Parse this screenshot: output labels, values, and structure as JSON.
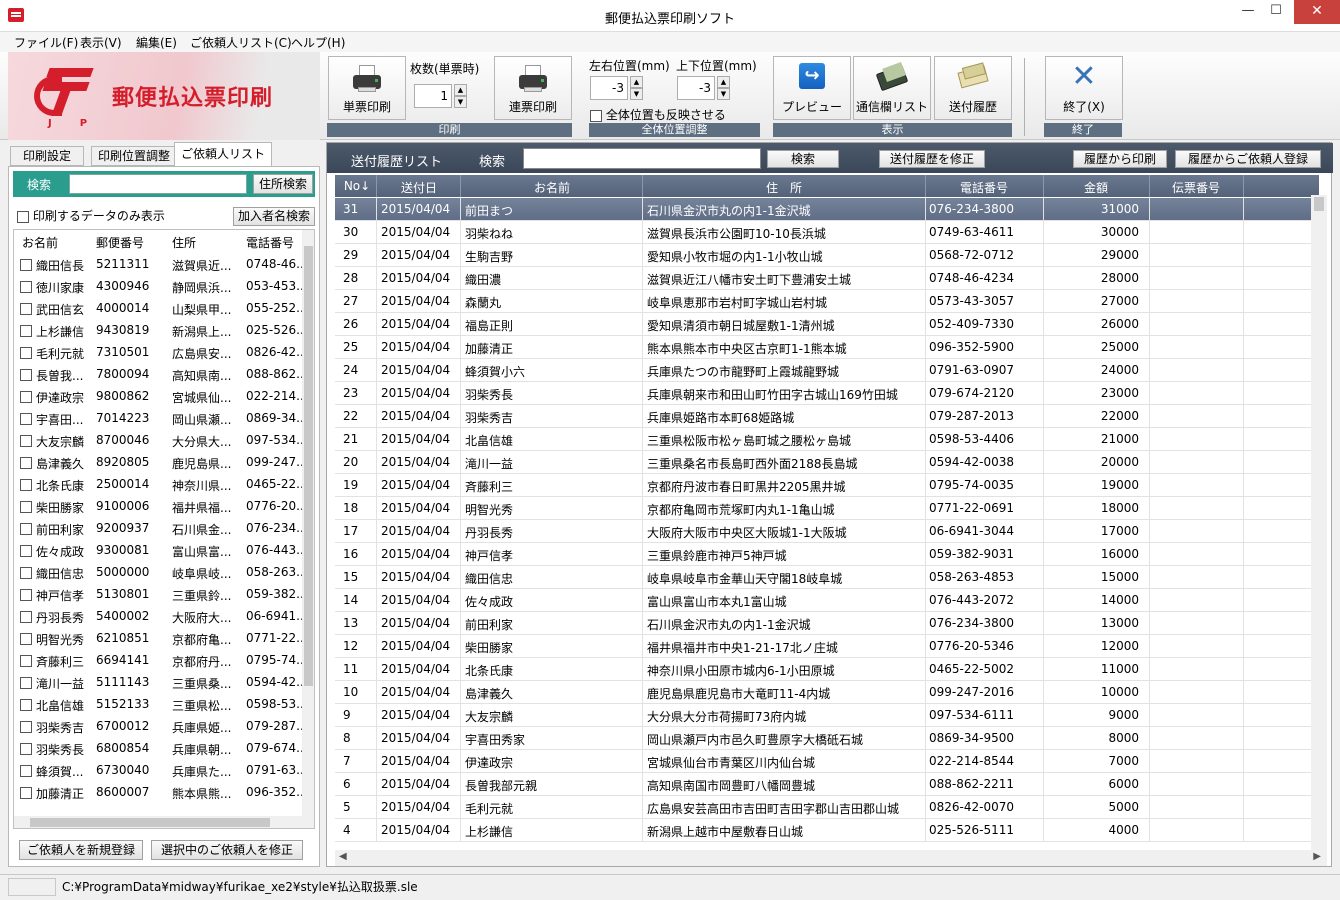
{
  "window": {
    "title": "郵便払込票印刷ソフト",
    "min": "—",
    "max": "☐",
    "close": "✕"
  },
  "menu": [
    "ファイル(F)",
    "表示(V)",
    "編集(E)",
    "ご依頼人リスト(C)",
    "ヘルプ(H)"
  ],
  "logo": {
    "jp": "JP",
    "name": "郵便払込票印刷"
  },
  "ribbon": {
    "print_group": "印刷",
    "single_print": "単票印刷",
    "count_label": "枚数(単票時)",
    "count_value": "1",
    "continuous_print": "連票印刷",
    "position_group": "全体位置調整",
    "lr_label": "左右位置(mm)",
    "lr_value": "-3",
    "tb_label": "上下位置(mm)",
    "tb_value": "-3",
    "apply_all": "全体位置も反映させる",
    "display_group": "表示",
    "preview": "プレビュー",
    "comm_list": "通信欄リスト",
    "send_history": "送付履歴",
    "end_group": "終了",
    "exit": "終了(X)"
  },
  "left": {
    "tabs": [
      "印刷設定",
      "印刷位置調整",
      "ご依頼人リスト"
    ],
    "search_label": "検索",
    "address_search": "住所検索",
    "only_print_label": "印刷するデータのみ表示",
    "name_search": "加入者名検索",
    "columns": [
      "お名前",
      "郵便番号",
      "住所",
      "電話番号"
    ],
    "rows": [
      [
        "織田信長",
        "5211311",
        "滋賀県近...",
        "0748-46..."
      ],
      [
        "徳川家康",
        "4300946",
        "静岡県浜...",
        "053-453..."
      ],
      [
        "武田信玄",
        "4000014",
        "山梨県甲...",
        "055-252..."
      ],
      [
        "上杉謙信",
        "9430819",
        "新潟県上...",
        "025-526..."
      ],
      [
        "毛利元就",
        "7310501",
        "広島県安...",
        "0826-42..."
      ],
      [
        "長曽我...",
        "7800094",
        "高知県南...",
        "088-862..."
      ],
      [
        "伊達政宗",
        "9800862",
        "宮城県仙...",
        "022-214..."
      ],
      [
        "宇喜田...",
        "7014223",
        "岡山県瀬...",
        "0869-34..."
      ],
      [
        "大友宗麟",
        "8700046",
        "大分県大...",
        "097-534..."
      ],
      [
        "島津義久",
        "8920805",
        "鹿児島県...",
        "099-247..."
      ],
      [
        "北条氏康",
        "2500014",
        "神奈川県...",
        "0465-22..."
      ],
      [
        "柴田勝家",
        "9100006",
        "福井県福...",
        "0776-20..."
      ],
      [
        "前田利家",
        "9200937",
        "石川県金...",
        "076-234..."
      ],
      [
        "佐々成政",
        "9300081",
        "富山県富...",
        "076-443..."
      ],
      [
        "織田信忠",
        "5000000",
        "岐阜県岐...",
        "058-263..."
      ],
      [
        "神戸信孝",
        "5130801",
        "三重県鈴...",
        "059-382..."
      ],
      [
        "丹羽長秀",
        "5400002",
        "大阪府大...",
        "06-6941..."
      ],
      [
        "明智光秀",
        "6210851",
        "京都府亀...",
        "0771-22..."
      ],
      [
        "斉藤利三",
        "6694141",
        "京都府丹...",
        "0795-74..."
      ],
      [
        "滝川一益",
        "5111143",
        "三重県桑...",
        "0594-42..."
      ],
      [
        "北畠信雄",
        "5152133",
        "三重県松...",
        "0598-53..."
      ],
      [
        "羽柴秀吉",
        "6700012",
        "兵庫県姫...",
        "079-287..."
      ],
      [
        "羽柴秀長",
        "6800854",
        "兵庫県朝...",
        "079-674..."
      ],
      [
        "蜂須賀...",
        "6730040",
        "兵庫県た...",
        "0791-63..."
      ],
      [
        "加藤清正",
        "8600007",
        "熊本県熊...",
        "096-352..."
      ]
    ],
    "new_client": "ご依頼人を新規登録",
    "edit_client": "選択中のご依頼人を修正"
  },
  "main": {
    "title": "送付履歴リスト",
    "search_label": "検索",
    "search_btn": "検索",
    "fix_history": "送付履歴を修正",
    "print_from_history": "履歴から印刷",
    "register_from_history": "履歴からご依頼人登録",
    "columns": [
      "No↓",
      "送付日",
      "お名前",
      "住　所",
      "電話番号",
      "金額",
      "伝票番号"
    ],
    "rows": [
      [
        "31",
        "2015/04/04",
        "前田まつ",
        "石川県金沢市丸の内1-1金沢城",
        "076-234-3800",
        "31000"
      ],
      [
        "30",
        "2015/04/04",
        "羽柴ねね",
        "滋賀県長浜市公園町10-10長浜城",
        "0749-63-4611",
        "30000"
      ],
      [
        "29",
        "2015/04/04",
        "生駒吉野",
        "愛知県小牧市堀の内1-1小牧山城",
        "0568-72-0712",
        "29000"
      ],
      [
        "28",
        "2015/04/04",
        "織田濃",
        "滋賀県近江八幡市安土町下豊浦安土城",
        "0748-46-4234",
        "28000"
      ],
      [
        "27",
        "2015/04/04",
        "森蘭丸",
        "岐阜県恵那市岩村町字城山岩村城",
        "0573-43-3057",
        "27000"
      ],
      [
        "26",
        "2015/04/04",
        "福島正則",
        "愛知県清須市朝日城屋敷1-1清州城",
        "052-409-7330",
        "26000"
      ],
      [
        "25",
        "2015/04/04",
        "加藤清正",
        "熊本県熊本市中央区古京町1-1熊本城",
        "096-352-5900",
        "25000"
      ],
      [
        "24",
        "2015/04/04",
        "蜂須賀小六",
        "兵庫県たつの市龍野町上霞城龍野城",
        "0791-63-0907",
        "24000"
      ],
      [
        "23",
        "2015/04/04",
        "羽柴秀長",
        "兵庫県朝来市和田山町竹田字古城山169竹田城",
        "079-674-2120",
        "23000"
      ],
      [
        "22",
        "2015/04/04",
        "羽柴秀吉",
        "兵庫県姫路市本町68姫路城",
        "079-287-2013",
        "22000"
      ],
      [
        "21",
        "2015/04/04",
        "北畠信雄",
        "三重県松阪市松ヶ島町城之腰松ヶ島城",
        "0598-53-4406",
        "21000"
      ],
      [
        "20",
        "2015/04/04",
        "滝川一益",
        "三重県桑名市長島町西外面2188長島城",
        "0594-42-0038",
        "20000"
      ],
      [
        "19",
        "2015/04/04",
        "斉藤利三",
        "京都府丹波市春日町黒井2205黒井城",
        "0795-74-0035",
        "19000"
      ],
      [
        "18",
        "2015/04/04",
        "明智光秀",
        "京都府亀岡市荒塚町内丸1-1亀山城",
        "0771-22-0691",
        "18000"
      ],
      [
        "17",
        "2015/04/04",
        "丹羽長秀",
        "大阪府大阪市中央区大阪城1-1大阪城",
        "06-6941-3044",
        "17000"
      ],
      [
        "16",
        "2015/04/04",
        "神戸信孝",
        "三重県鈴鹿市神戸5神戸城",
        "059-382-9031",
        "16000"
      ],
      [
        "15",
        "2015/04/04",
        "織田信忠",
        "岐阜県岐阜市金華山天守閣18岐阜城",
        "058-263-4853",
        "15000"
      ],
      [
        "14",
        "2015/04/04",
        "佐々成政",
        "富山県富山市本丸1富山城",
        "076-443-2072",
        "14000"
      ],
      [
        "13",
        "2015/04/04",
        "前田利家",
        "石川県金沢市丸の内1-1金沢城",
        "076-234-3800",
        "13000"
      ],
      [
        "12",
        "2015/04/04",
        "柴田勝家",
        "福井県福井市中央1-21-17北ノ庄城",
        "0776-20-5346",
        "12000"
      ],
      [
        "11",
        "2015/04/04",
        "北条氏康",
        "神奈川県小田原市城内6-1小田原城",
        "0465-22-5002",
        "11000"
      ],
      [
        "10",
        "2015/04/04",
        "島津義久",
        "鹿児島県鹿児島市大竜町11-4内城",
        "099-247-2016",
        "10000"
      ],
      [
        "9",
        "2015/04/04",
        "大友宗麟",
        "大分県大分市荷揚町73府内城",
        "097-534-6111",
        "9000"
      ],
      [
        "8",
        "2015/04/04",
        "宇喜田秀家",
        "岡山県瀬戸内市邑久町豊原字大橋砥石城",
        "0869-34-9500",
        "8000"
      ],
      [
        "7",
        "2015/04/04",
        "伊達政宗",
        "宮城県仙台市青葉区川内仙台城",
        "022-214-8544",
        "7000"
      ],
      [
        "6",
        "2015/04/04",
        "長曽我部元親",
        "高知県南国市岡豊町八幡岡豊城",
        "088-862-2211",
        "6000"
      ],
      [
        "5",
        "2015/04/04",
        "毛利元就",
        "広島県安芸高田市吉田町吉田字郡山吉田郡山城",
        "0826-42-0070",
        "5000"
      ],
      [
        "4",
        "2015/04/04",
        "上杉謙信",
        "新潟県上越市中屋敷春日山城",
        "025-526-5111",
        "4000"
      ]
    ]
  },
  "status": {
    "path": "C:¥ProgramData¥midway¥furikae_xe2¥style¥払込取扱票.sle"
  }
}
